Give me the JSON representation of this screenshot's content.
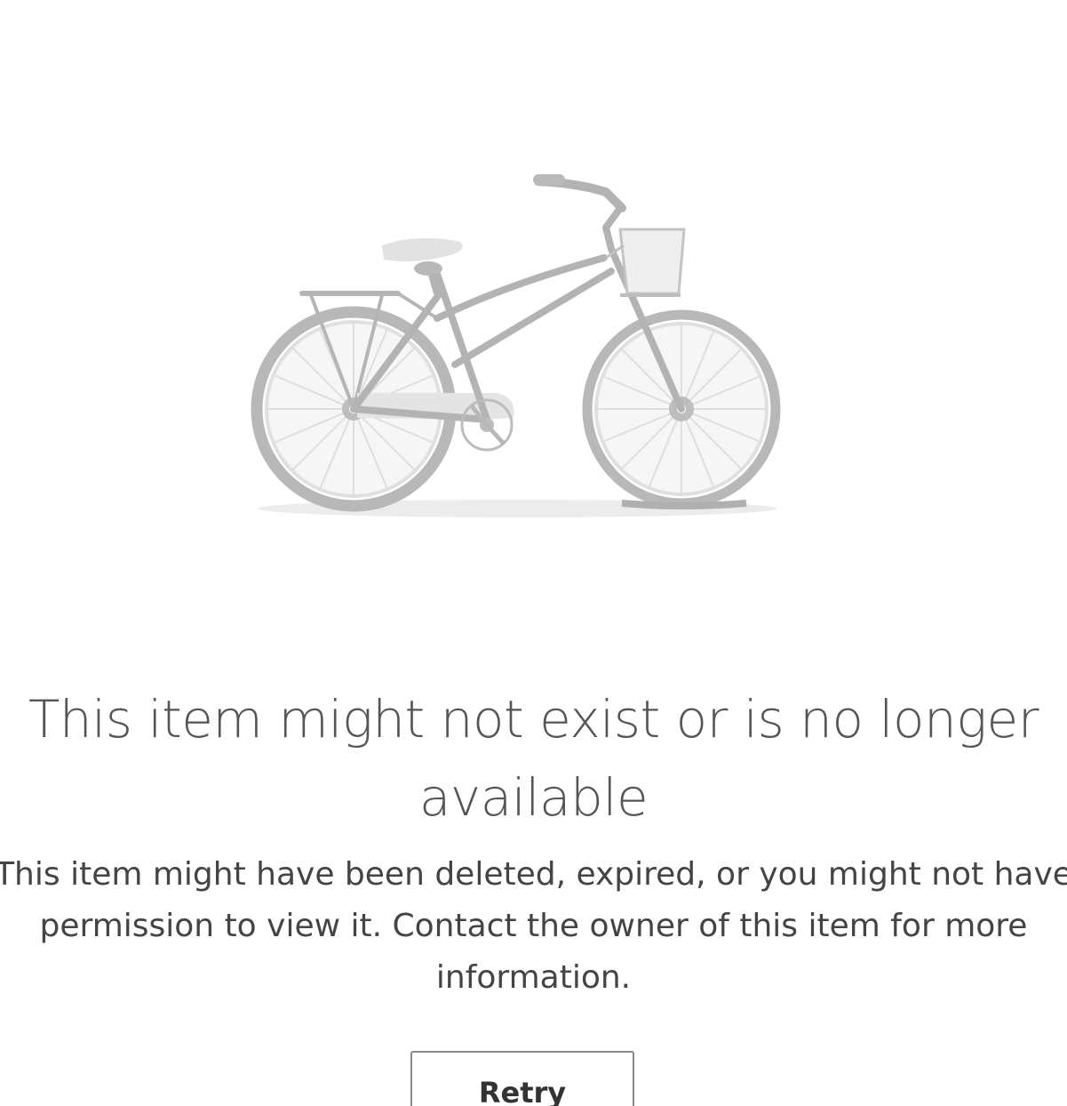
{
  "error": {
    "illustration_icon": "bicycle-illustration",
    "title": "This item might not exist or is no longer available",
    "description": "This item might have been deleted, expired, or you might not have permission to view it. Contact the owner of this item for more information.",
    "retry_label": "Retry"
  },
  "colors": {
    "illustration_dark": "#b3b3b3",
    "illustration_light": "#e3e3e3",
    "title_text": "#555555",
    "body_text": "#444444"
  }
}
